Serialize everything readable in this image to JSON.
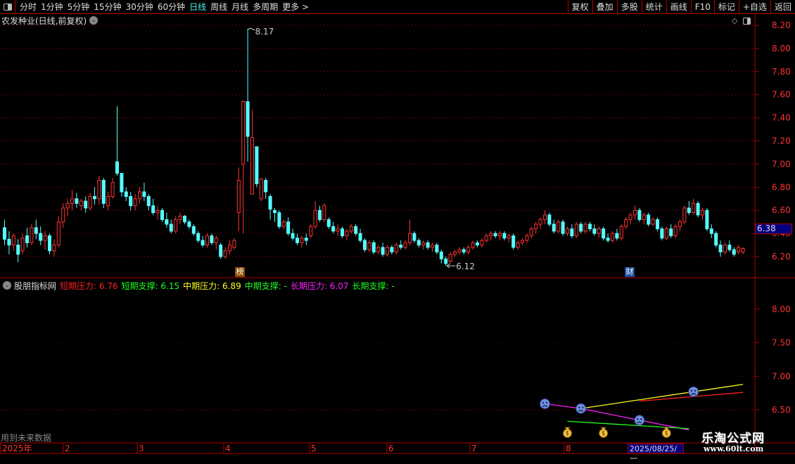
{
  "toolbar": {
    "periods": [
      "分时",
      "1分钟",
      "5分钟",
      "15分钟",
      "30分钟",
      "60分钟",
      "日线",
      "周线",
      "月线",
      "多周期",
      "更多 >"
    ],
    "active": "日线",
    "right_buttons": [
      "复权",
      "叠加",
      "多股",
      "统计",
      "画线",
      "F10",
      "标记",
      "+自选",
      "返回"
    ]
  },
  "stock": {
    "title": "农发种业(日线,前复权)",
    "current_price": "6.38"
  },
  "indicator": {
    "name": "股朋指标网",
    "items": [
      {
        "label": "短期压力: 6.76",
        "color": "#ff2020"
      },
      {
        "label": "短期支撑: 6.15",
        "color": "#20ff20"
      },
      {
        "label": "中期压力: 6.89",
        "color": "#ffff20"
      },
      {
        "label": "中期支撑: -",
        "color": "#20ff20"
      },
      {
        "label": "长期压力: 6.07",
        "color": "#ff20ff"
      },
      {
        "label": "长期支撑: -",
        "color": "#20ff20"
      }
    ],
    "note": "用到未来数据"
  },
  "markers": {
    "bang": "榜",
    "cai": "财"
  },
  "watermark": {
    "name": "乐淘公式网",
    "url": "www.60lt.com"
  },
  "colors": {
    "up": "#ff3232",
    "down": "#54ffff",
    "grid": "#b00000",
    "axis_text": "#ff3232"
  },
  "chart_data": [
    {
      "type": "candlestick",
      "title": "农发种业(日线,前复权)",
      "ylim": [
        6.1,
        8.25
      ],
      "yticks": [
        "8.20",
        "8.00",
        "7.80",
        "7.60",
        "7.40",
        "7.20",
        "7.00",
        "6.80",
        "6.60",
        "6.40",
        "6.20"
      ],
      "annotations": [
        {
          "label": "8.17",
          "value": 8.17,
          "type": "high"
        },
        {
          "label": "6.12",
          "value": 6.12,
          "type": "low"
        }
      ],
      "xlabels": [
        "2025年",
        "2",
        "3",
        "4",
        "5",
        "6",
        "7",
        "8"
      ],
      "cursor_date": "2025/08/25/一",
      "ohlc_fields": [
        "open",
        "high",
        "low",
        "close"
      ],
      "ohlc": [
        [
          6.45,
          6.52,
          6.3,
          6.35
        ],
        [
          6.35,
          6.42,
          6.22,
          6.3
        ],
        [
          6.3,
          6.4,
          6.25,
          6.38
        ],
        [
          6.3,
          6.35,
          6.15,
          6.22
        ],
        [
          6.25,
          6.4,
          6.22,
          6.36
        ],
        [
          6.38,
          6.45,
          6.28,
          6.32
        ],
        [
          6.32,
          6.48,
          6.3,
          6.45
        ],
        [
          6.45,
          6.52,
          6.35,
          6.4
        ],
        [
          6.4,
          6.46,
          6.3,
          6.34
        ],
        [
          6.34,
          6.42,
          6.26,
          6.38
        ],
        [
          6.38,
          6.4,
          6.22,
          6.25
        ],
        [
          6.25,
          6.35,
          6.2,
          6.3
        ],
        [
          6.3,
          6.55,
          6.28,
          6.5
        ],
        [
          6.5,
          6.66,
          6.45,
          6.62
        ],
        [
          6.62,
          6.7,
          6.55,
          6.66
        ],
        [
          6.66,
          6.78,
          6.6,
          6.7
        ],
        [
          6.7,
          6.75,
          6.62,
          6.66
        ],
        [
          6.64,
          6.7,
          6.6,
          6.68
        ],
        [
          6.68,
          6.72,
          6.58,
          6.62
        ],
        [
          6.62,
          6.75,
          6.6,
          6.72
        ],
        [
          6.72,
          6.8,
          6.65,
          6.7
        ],
        [
          6.7,
          6.9,
          6.65,
          6.86
        ],
        [
          6.86,
          6.88,
          6.62,
          6.66
        ],
        [
          6.64,
          6.76,
          6.6,
          6.72
        ],
        [
          6.72,
          6.88,
          6.7,
          6.84
        ],
        [
          7.02,
          7.5,
          6.9,
          6.92
        ],
        [
          6.92,
          6.92,
          6.72,
          6.76
        ],
        [
          6.76,
          6.8,
          6.68,
          6.72
        ],
        [
          6.72,
          6.76,
          6.6,
          6.64
        ],
        [
          6.64,
          6.74,
          6.6,
          6.7
        ],
        [
          6.7,
          6.8,
          6.66,
          6.76
        ],
        [
          6.76,
          6.84,
          6.68,
          6.72
        ],
        [
          6.72,
          6.74,
          6.6,
          6.64
        ],
        [
          6.64,
          6.7,
          6.56,
          6.58
        ],
        [
          6.58,
          6.64,
          6.52,
          6.6
        ],
        [
          6.6,
          6.62,
          6.5,
          6.52
        ],
        [
          6.52,
          6.58,
          6.45,
          6.48
        ],
        [
          6.48,
          6.52,
          6.4,
          6.42
        ],
        [
          6.42,
          6.55,
          6.4,
          6.52
        ],
        [
          6.52,
          6.58,
          6.48,
          6.55
        ],
        [
          6.55,
          6.56,
          6.48,
          6.5
        ],
        [
          6.5,
          6.52,
          6.44,
          6.46
        ],
        [
          6.46,
          6.48,
          6.38,
          6.4
        ],
        [
          6.4,
          6.42,
          6.32,
          6.34
        ],
        [
          6.34,
          6.38,
          6.28,
          6.3
        ],
        [
          6.3,
          6.4,
          6.28,
          6.38
        ],
        [
          6.38,
          6.4,
          6.3,
          6.32
        ],
        [
          6.32,
          6.38,
          6.26,
          6.36
        ],
        [
          6.3,
          6.32,
          6.18,
          6.2
        ],
        [
          6.2,
          6.28,
          6.18,
          6.25
        ],
        [
          6.25,
          6.34,
          6.22,
          6.3
        ],
        [
          6.28,
          6.36,
          6.26,
          6.34
        ],
        [
          6.58,
          6.97,
          6.42,
          6.86
        ],
        [
          7.0,
          7.55,
          6.4,
          7.54
        ],
        [
          7.54,
          8.17,
          7.02,
          7.24
        ],
        [
          6.74,
          7.47,
          6.74,
          7.23
        ],
        [
          7.15,
          7.15,
          6.8,
          6.83
        ],
        [
          6.7,
          6.88,
          6.68,
          6.87
        ],
        [
          6.86,
          6.88,
          6.7,
          6.76
        ],
        [
          6.72,
          6.74,
          6.52,
          6.61
        ],
        [
          6.6,
          6.62,
          6.5,
          6.58
        ],
        [
          6.58,
          6.6,
          6.44,
          6.46
        ],
        [
          6.46,
          6.52,
          6.44,
          6.5
        ],
        [
          6.5,
          6.54,
          6.38,
          6.4
        ],
        [
          6.4,
          6.44,
          6.34,
          6.36
        ],
        [
          6.36,
          6.4,
          6.3,
          6.32
        ],
        [
          6.32,
          6.38,
          6.28,
          6.36
        ],
        [
          6.36,
          6.4,
          6.3,
          6.34
        ],
        [
          6.38,
          6.48,
          6.36,
          6.46
        ],
        [
          6.46,
          6.68,
          6.44,
          6.6
        ],
        [
          6.6,
          6.64,
          6.5,
          6.52
        ],
        [
          6.52,
          6.66,
          6.5,
          6.64
        ],
        [
          6.52,
          6.54,
          6.44,
          6.46
        ],
        [
          6.46,
          6.5,
          6.4,
          6.42
        ],
        [
          6.42,
          6.48,
          6.38,
          6.44
        ],
        [
          6.44,
          6.46,
          6.36,
          6.38
        ],
        [
          6.38,
          6.44,
          6.34,
          6.42
        ],
        [
          6.42,
          6.48,
          6.4,
          6.46
        ],
        [
          6.46,
          6.48,
          6.38,
          6.4
        ],
        [
          6.4,
          6.44,
          6.32,
          6.34
        ],
        [
          6.34,
          6.36,
          6.24,
          6.26
        ],
        [
          6.26,
          6.34,
          6.24,
          6.32
        ],
        [
          6.32,
          6.34,
          6.22,
          6.24
        ],
        [
          6.24,
          6.3,
          6.22,
          6.28
        ],
        [
          6.28,
          6.32,
          6.2,
          6.22
        ],
        [
          6.22,
          6.3,
          6.2,
          6.28
        ],
        [
          6.28,
          6.3,
          6.22,
          6.24
        ],
        [
          6.24,
          6.32,
          6.22,
          6.3
        ],
        [
          6.3,
          6.34,
          6.26,
          6.28
        ],
        [
          6.28,
          6.34,
          6.26,
          6.32
        ],
        [
          6.32,
          6.52,
          6.3,
          6.4
        ],
        [
          6.4,
          6.42,
          6.32,
          6.34
        ],
        [
          6.34,
          6.36,
          6.28,
          6.3
        ],
        [
          6.3,
          6.34,
          6.26,
          6.32
        ],
        [
          6.32,
          6.34,
          6.26,
          6.28
        ],
        [
          6.28,
          6.32,
          6.24,
          6.3
        ],
        [
          6.3,
          6.32,
          6.22,
          6.24
        ],
        [
          6.24,
          6.26,
          6.14,
          6.18
        ],
        [
          6.18,
          6.2,
          6.12,
          6.14
        ],
        [
          6.16,
          6.24,
          6.14,
          6.22
        ],
        [
          6.22,
          6.26,
          6.2,
          6.24
        ],
        [
          6.24,
          6.28,
          6.22,
          6.26
        ],
        [
          6.26,
          6.28,
          6.22,
          6.24
        ],
        [
          6.24,
          6.3,
          6.22,
          6.28
        ],
        [
          6.28,
          6.34,
          6.26,
          6.32
        ],
        [
          6.32,
          6.34,
          6.28,
          6.3
        ],
        [
          6.3,
          6.36,
          6.28,
          6.34
        ],
        [
          6.34,
          6.4,
          6.32,
          6.38
        ],
        [
          6.38,
          6.42,
          6.34,
          6.4
        ],
        [
          6.4,
          6.42,
          6.36,
          6.38
        ],
        [
          6.38,
          6.42,
          6.34,
          6.4
        ],
        [
          6.4,
          6.42,
          6.34,
          6.36
        ],
        [
          6.36,
          6.4,
          6.32,
          6.38
        ],
        [
          6.38,
          6.4,
          6.26,
          6.28
        ],
        [
          6.28,
          6.34,
          6.26,
          6.32
        ],
        [
          6.32,
          6.36,
          6.3,
          6.34
        ],
        [
          6.34,
          6.4,
          6.32,
          6.38
        ],
        [
          6.38,
          6.46,
          6.36,
          6.44
        ],
        [
          6.44,
          6.5,
          6.4,
          6.48
        ],
        [
          6.48,
          6.54,
          6.44,
          6.52
        ],
        [
          6.52,
          6.6,
          6.48,
          6.56
        ],
        [
          6.56,
          6.58,
          6.46,
          6.48
        ],
        [
          6.48,
          6.52,
          6.4,
          6.42
        ],
        [
          6.42,
          6.52,
          6.4,
          6.5
        ],
        [
          6.5,
          6.52,
          6.38,
          6.4
        ],
        [
          6.4,
          6.46,
          6.38,
          6.44
        ],
        [
          6.44,
          6.48,
          6.36,
          6.38
        ],
        [
          6.38,
          6.5,
          6.36,
          6.48
        ],
        [
          6.48,
          6.5,
          6.4,
          6.42
        ],
        [
          6.42,
          6.5,
          6.4,
          6.48
        ],
        [
          6.48,
          6.5,
          6.42,
          6.44
        ],
        [
          6.44,
          6.48,
          6.38,
          6.4
        ],
        [
          6.4,
          6.46,
          6.36,
          6.44
        ],
        [
          6.44,
          6.46,
          6.34,
          6.36
        ],
        [
          6.36,
          6.4,
          6.32,
          6.34
        ],
        [
          6.34,
          6.42,
          6.32,
          6.4
        ],
        [
          6.4,
          6.44,
          6.34,
          6.36
        ],
        [
          6.36,
          6.48,
          6.34,
          6.46
        ],
        [
          6.46,
          6.54,
          6.44,
          6.52
        ],
        [
          6.52,
          6.58,
          6.48,
          6.56
        ],
        [
          6.56,
          6.64,
          6.52,
          6.6
        ],
        [
          6.6,
          6.62,
          6.5,
          6.52
        ],
        [
          6.52,
          6.58,
          6.48,
          6.56
        ],
        [
          6.56,
          6.58,
          6.46,
          6.48
        ],
        [
          6.48,
          6.54,
          6.46,
          6.52
        ],
        [
          6.52,
          6.54,
          6.42,
          6.44
        ],
        [
          6.44,
          6.46,
          6.34,
          6.36
        ],
        [
          6.36,
          6.46,
          6.34,
          6.44
        ],
        [
          6.44,
          6.48,
          6.36,
          6.38
        ],
        [
          6.38,
          6.48,
          6.36,
          6.46
        ],
        [
          6.46,
          6.52,
          6.42,
          6.5
        ],
        [
          6.5,
          6.64,
          6.48,
          6.62
        ],
        [
          6.62,
          6.68,
          6.56,
          6.58
        ],
        [
          6.58,
          6.7,
          6.56,
          6.66
        ],
        [
          6.66,
          6.68,
          6.54,
          6.56
        ],
        [
          6.56,
          6.62,
          6.52,
          6.6
        ],
        [
          6.6,
          6.62,
          6.42,
          6.44
        ],
        [
          6.44,
          6.48,
          6.36,
          6.4
        ],
        [
          6.4,
          6.42,
          6.28,
          6.3
        ],
        [
          6.3,
          6.34,
          6.2,
          6.24
        ],
        [
          6.24,
          6.32,
          6.22,
          6.3
        ],
        [
          6.3,
          6.34,
          6.24,
          6.26
        ],
        [
          6.26,
          6.28,
          6.2,
          6.22
        ],
        [
          6.24,
          6.3,
          6.22,
          6.28
        ],
        [
          6.24,
          6.28,
          6.22,
          6.27
        ]
      ]
    },
    {
      "type": "line",
      "title": "股朋指标网",
      "ylim": [
        6.1,
        8.4
      ],
      "yticks": [
        "8.00",
        "7.50",
        "7.00",
        "6.50"
      ],
      "series_fields": [
        "candle_index",
        "value"
      ],
      "series": [
        {
          "color": "#ff20ff",
          "points": [
            [
              120,
              6.59
            ],
            [
              128,
              6.52
            ],
            [
              152,
              6.2
            ]
          ]
        },
        {
          "color": "#ffff20",
          "points": [
            [
              128,
              6.52
            ],
            [
              164,
              6.88
            ]
          ]
        },
        {
          "color": "#ff2020",
          "points": [
            [
              141,
              6.63
            ],
            [
              164,
              6.76
            ]
          ]
        },
        {
          "color": "#20ff20",
          "points": [
            [
              125,
              6.33
            ],
            [
              152,
              6.22
            ]
          ]
        }
      ],
      "sad_face_markers": [
        120,
        128,
        141,
        153
      ],
      "money_bag_markers": [
        125,
        133,
        147
      ],
      "reference_line": 6.5
    }
  ]
}
